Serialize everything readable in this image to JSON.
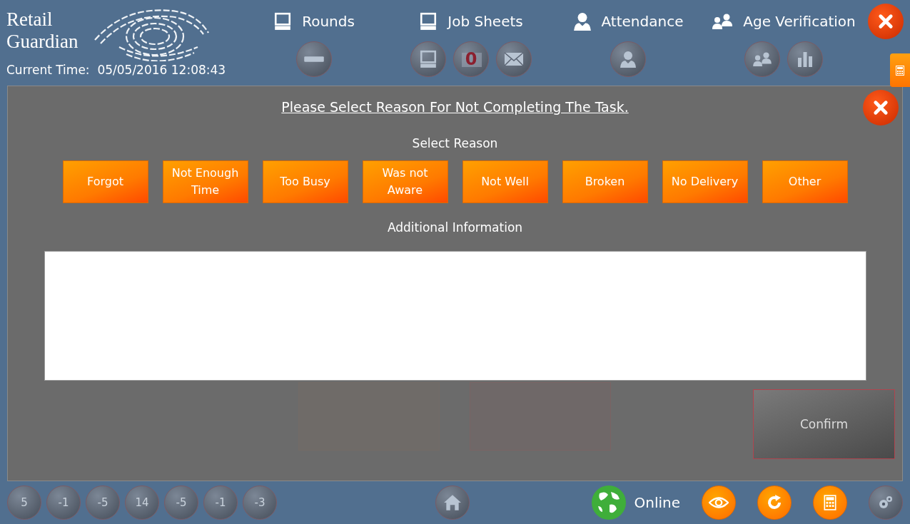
{
  "brand": {
    "line1": "Retail",
    "line2": "Guardian"
  },
  "clock": {
    "label": "Current Time:",
    "value": "05/05/2016 12:08:43"
  },
  "nav": [
    {
      "label": "Rounds"
    },
    {
      "label": "Job Sheets",
      "badge": "0"
    },
    {
      "label": "Attendance"
    },
    {
      "label": "Age Verification"
    }
  ],
  "background_task": {
    "confirm": "Confirm"
  },
  "dialog": {
    "title": "Please Select Reason For Not Completing The Task.",
    "select_label": "Select Reason",
    "reasons": [
      {
        "label": "Forgot"
      },
      {
        "label": "Not Enough Time"
      },
      {
        "label": "Too Busy"
      },
      {
        "label": "Was not Aware"
      },
      {
        "label": "Not Well"
      },
      {
        "label": "Broken"
      },
      {
        "label": "No Delivery"
      },
      {
        "label": "Other"
      }
    ],
    "info_label": "Additional Information"
  },
  "counters": [
    "5",
    "-1",
    "-5",
    "14",
    "-5",
    "-1",
    "-3"
  ],
  "status": {
    "label": "Online"
  }
}
